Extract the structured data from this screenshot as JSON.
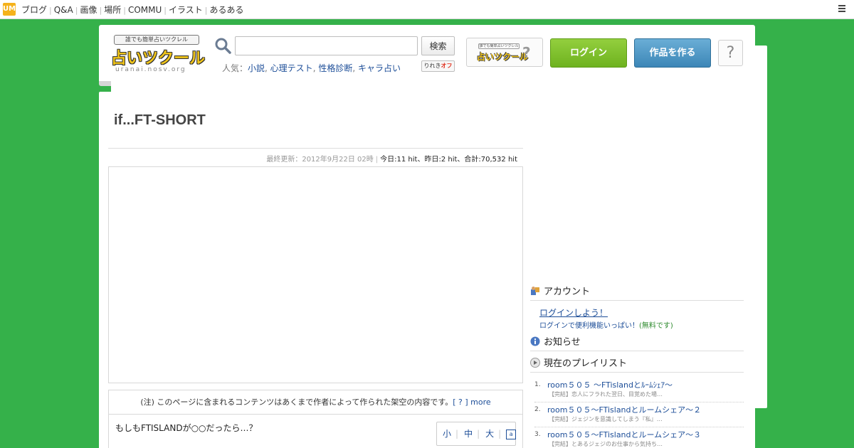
{
  "topbar": {
    "logo": "UM",
    "nav": [
      "ブログ",
      "Q&A",
      "画像",
      "場所",
      "COMMU",
      "イラスト",
      "あるある"
    ],
    "menu_icon": "hamburger-icon"
  },
  "header": {
    "logo_banner": "誰でも簡単占いツクレル",
    "logo_main": "占いツクール",
    "logo_url": "uranai.nosv.org",
    "search_placeholder": "",
    "search_button": "検索",
    "popular_label": "人気：",
    "popular_links": [
      "小説",
      "心理テスト",
      "性格診断",
      "キャラ占い"
    ],
    "rireki_label": "りれき",
    "rireki_state": "オフ",
    "small_logo_banner": "誰でも簡単占いツクレル",
    "small_logo_main": "占いツクール",
    "small_logo_q": "?",
    "login_button": "ログイン",
    "create_button": "作品を作る",
    "help_button": "?"
  },
  "main": {
    "title": "if...FT-SHORT",
    "last_updated": "最終更新：2012年9月22日 02時",
    "hits": "今日:11 hit、昨日:2 hit、合計:70,532 hit",
    "notice": "(注) このページに含まれるコンテンツはあくまで作者によって作られた架空の内容です。",
    "notice_help": "[ ? ]",
    "notice_more": "more",
    "body_text": "もしもFTISLANDが○○だったら…？",
    "font_small": "小",
    "font_medium": "中",
    "font_large": "大",
    "font_icon": "font-settings-icon"
  },
  "sidebar": {
    "account_heading": "アカウント",
    "login_link": "ログインしよう！",
    "login_sub": "ログインで便利機能いっぱい！",
    "login_free": "(無料です)",
    "notice_heading": "お知らせ",
    "playlist_heading": "現在のプレイリスト",
    "playlist": [
      {
        "num": "1.",
        "title": "room５０５ ～FTislandとﾙｰﾑｼｪｱ～",
        "desc": "【完結】恋人にフラれた翌日、目覚めた場…"
      },
      {
        "num": "2.",
        "title": "room５０５～FTislandとルームシェア～２",
        "desc": "【完結】ジェジンを意識してしまう『私』…"
      },
      {
        "num": "3.",
        "title": "room５０５～FTislandとルームシェア～３",
        "desc": "【完結】とあるジェジのお仕事から気持ち…"
      }
    ]
  }
}
